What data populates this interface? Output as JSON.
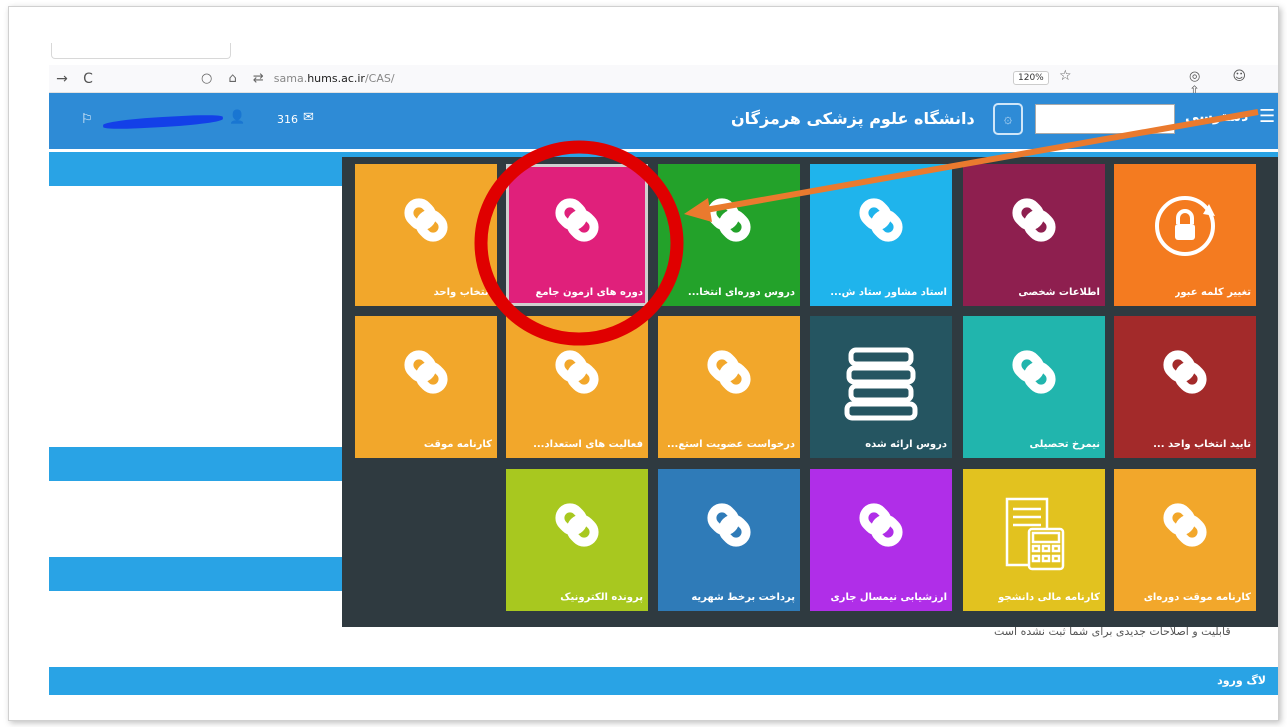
{
  "browser": {
    "back_glyph": "→",
    "reload_glyph": "C",
    "url_prefix": "sama.",
    "url_domain": "hums.ac.ir",
    "url_path": "/CAS/",
    "zoom": "120%"
  },
  "header": {
    "university_title": "دانشگاه علوم پزشکی هرمزگان",
    "message_count": "316",
    "access_label": "دسترسی"
  },
  "tiles": [
    {
      "label": "تغییر کلمه عبور",
      "color": "#f47b20",
      "icon": "lock-refresh-icon"
    },
    {
      "label": "اطلاعات شخصی",
      "color": "#8e1f4f",
      "icon": "link-icon"
    },
    {
      "label": "استاد مشاور ستاد ش...",
      "color": "#1fb4ec",
      "icon": "link-icon"
    },
    {
      "label": "دروس دوره‌ای انتخا...",
      "color": "#23a22a",
      "icon": "link-icon"
    },
    {
      "label": "دوره های آزمون جامع",
      "color": "#e0207b",
      "icon": "link-icon"
    },
    {
      "label": "انتخاب واحد",
      "color": "#f2a72b",
      "icon": "link-icon"
    },
    {
      "label": "تایید انتخاب واحد ...",
      "color": "#a32a2a",
      "icon": "link-icon"
    },
    {
      "label": "نیمرخ تحصیلی",
      "color": "#21b5ad",
      "icon": "link-icon"
    },
    {
      "label": "دروس ارائه شده",
      "color": "#255561",
      "icon": "books-icon"
    },
    {
      "label": "درخواست عضویت استع...",
      "color": "#f2a72b",
      "icon": "link-icon"
    },
    {
      "label": "فعالیت های استعداد...",
      "color": "#f2a72b",
      "icon": "link-icon"
    },
    {
      "label": "کارنامه موقت",
      "color": "#f2a72b",
      "icon": "link-icon"
    },
    {
      "label": "کارنامه موقت دوره‌ای",
      "color": "#f2a72b",
      "icon": "link-icon"
    },
    {
      "label": "کارنامه مالی دانشجو",
      "color": "#e2c21f",
      "icon": "calculator-icon"
    },
    {
      "label": "ارزشیابی نیمسال جاری",
      "color": "#b02ee8",
      "icon": "link-icon"
    },
    {
      "label": "پرداخت برخط شهریه",
      "color": "#2f7bb8",
      "icon": "link-icon"
    },
    {
      "label": "پرونده الکترونیک",
      "color": "#a8c81f",
      "icon": "link-icon"
    }
  ],
  "page": {
    "notice": "قابلیت و اصلاحات جدیدی برای شما ثبت نشده است",
    "login_log": "لاگ ورود"
  },
  "annotation": {
    "circle_color": "#e00000",
    "arrow_color": "#ea7a2e"
  }
}
